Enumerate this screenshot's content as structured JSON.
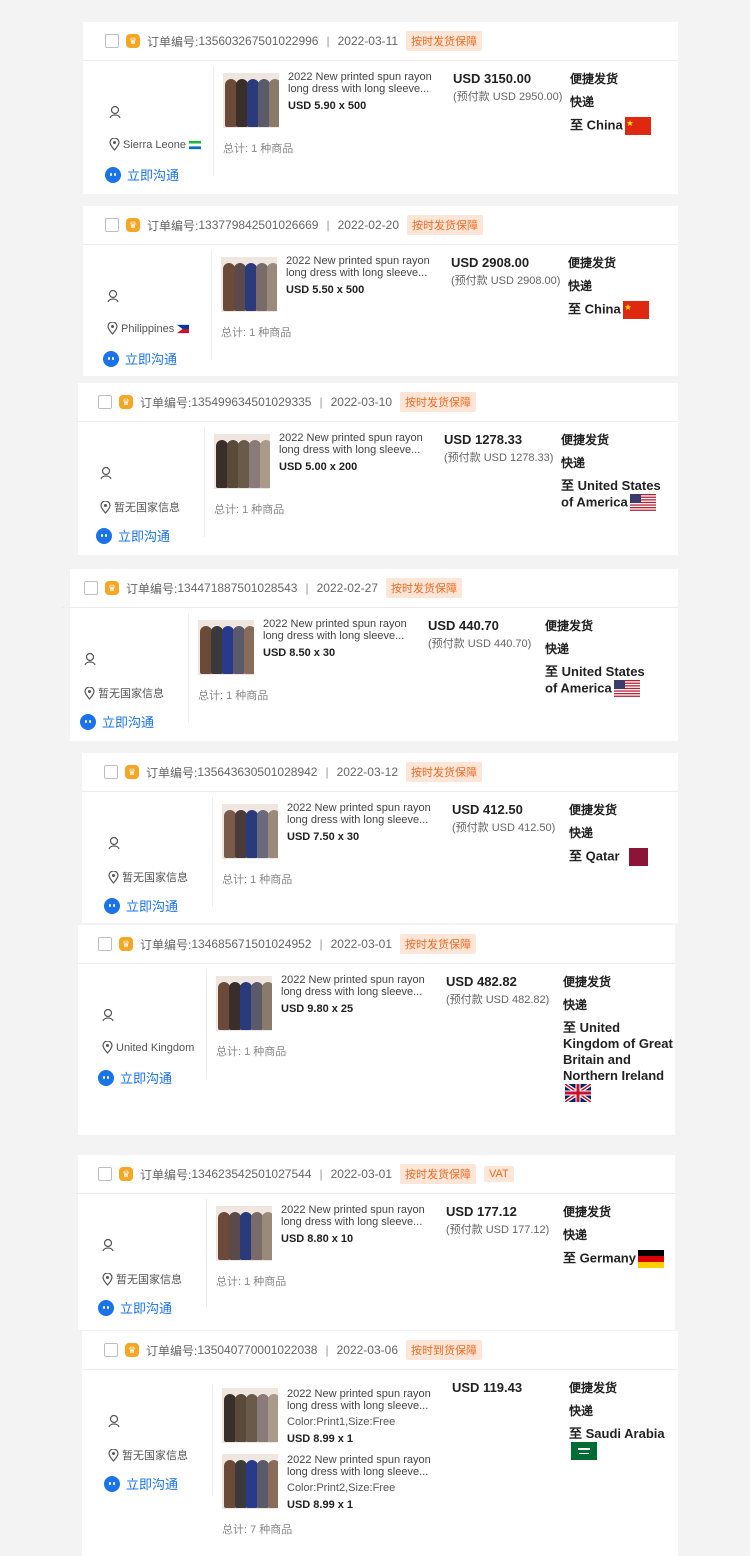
{
  "common": {
    "order_prefix": "订单编号:",
    "chat_label": "立即沟通",
    "product_title_1": "2022 New printed spun rayon",
    "product_title_2": "long dress with long sleeve..."
  },
  "orders": [
    {
      "order_no": "135603267501022996",
      "date": "2022-03-11",
      "badges": [
        "按时发货保障"
      ],
      "country": "Sierra Leone",
      "price_line": "USD 5.90 x 500",
      "total": "总计: 1 种商品",
      "amount": "USD 3150.00",
      "prepay": "(预付款 USD 2950.00)",
      "ship_line1": "便捷发货",
      "ship_line2": "快递",
      "destination": "至 China"
    },
    {
      "order_no": "133779842501026669",
      "date": "2022-02-20",
      "badges": [
        "按时发货保障"
      ],
      "country": "Philippines",
      "price_line": "USD 5.50 x 500",
      "total": "总计: 1 种商品",
      "amount": "USD 2908.00",
      "prepay": "(预付款 USD 2908.00)",
      "ship_line1": "便捷发货",
      "ship_line2": "快递",
      "destination": "至 China"
    },
    {
      "order_no": "135499634501029335",
      "date": "2022-03-10",
      "badges": [
        "按时发货保障"
      ],
      "country": "暂无国家信息",
      "price_line": "USD 5.00 x 200",
      "total": "总计: 1 种商品",
      "amount": "USD 1278.33",
      "prepay": "(预付款 USD 1278.33)",
      "ship_line1": "便捷发货",
      "ship_line2": "快递",
      "destination": "至 United States of America"
    },
    {
      "order_no": "134471887501028543",
      "date": "2022-02-27",
      "badges": [
        "按时发货保障"
      ],
      "country": "暂无国家信息",
      "price_line": "USD 8.50 x 30",
      "total": "总计: 1 种商品",
      "amount": "USD 440.70",
      "prepay": "(预付款 USD 440.70)",
      "ship_line1": "便捷发货",
      "ship_line2": "快递",
      "destination": "至 United States of America"
    },
    {
      "order_no": "135643630501028942",
      "date": "2022-03-12",
      "badges": [
        "按时发货保障"
      ],
      "country": "暂无国家信息",
      "price_line": "USD 7.50 x 30",
      "total": "总计: 1 种商品",
      "amount": "USD 412.50",
      "prepay": "(预付款 USD 412.50)",
      "ship_line1": "便捷发货",
      "ship_line2": "快递",
      "destination": "至 Qatar"
    },
    {
      "order_no": "134685671501024952",
      "date": "2022-03-01",
      "badges": [
        "按时发货保障"
      ],
      "country": "United Kingdom",
      "price_line": "USD 9.80 x 25",
      "total": "总计: 1 种商品",
      "amount": "USD 482.82",
      "prepay": "(预付款 USD 482.82)",
      "ship_line1": "便捷发货",
      "ship_line2": "快递",
      "destination": "至 United Kingdom of Great Britain and Northern Ireland"
    },
    {
      "order_no": "134623542501027544",
      "date": "2022-03-01",
      "badges": [
        "按时发货保障",
        "VAT"
      ],
      "country": "暂无国家信息",
      "price_line": "USD 8.80 x 10",
      "total": "总计: 1 种商品",
      "amount": "USD 177.12",
      "prepay": "(预付款 USD 177.12)",
      "ship_line1": "便捷发货",
      "ship_line2": "快递",
      "destination": "至 Germany"
    },
    {
      "order_no": "135040770001022038",
      "date": "2022-03-06",
      "badges": [
        "按时到货保障"
      ],
      "country": "暂无国家信息",
      "items": [
        {
          "variant": "Color:Print1,Size:Free",
          "price_line": "USD 8.99 x 1"
        },
        {
          "variant": "Color:Print2,Size:Free",
          "price_line": "USD 8.99 x 1"
        }
      ],
      "total": "总计: 7 种商品",
      "amount": "USD 119.43",
      "prepay": "",
      "ship_line1": "便捷发货",
      "ship_line2": "快递",
      "destination": "至 Saudi Arabia"
    }
  ],
  "icons": {
    "checkbox": "checkbox",
    "crown": "crown-icon",
    "user": "user-icon",
    "location": "location-pin-icon",
    "chat": "chat-bubble-icon"
  },
  "colors": {
    "badge_bg": "#fde6d8",
    "badge_text": "#f26a22",
    "link": "#1a73e8",
    "crown": "#f5a623"
  }
}
